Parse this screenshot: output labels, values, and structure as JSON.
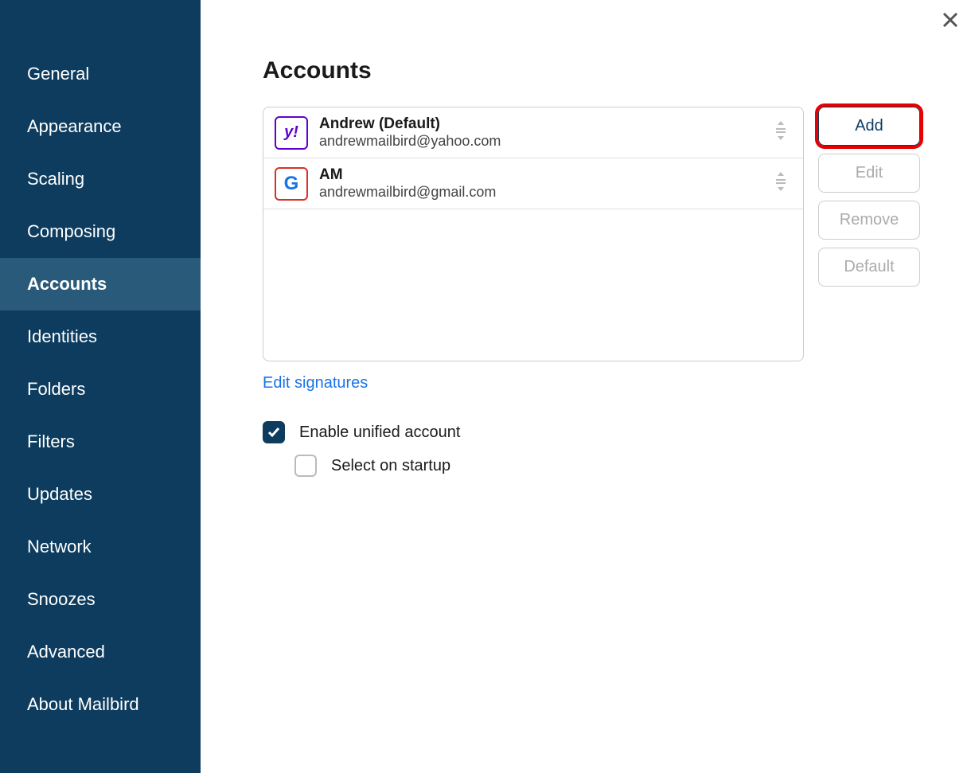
{
  "sidebar": {
    "items": [
      {
        "label": "General",
        "id": "general"
      },
      {
        "label": "Appearance",
        "id": "appearance"
      },
      {
        "label": "Scaling",
        "id": "scaling"
      },
      {
        "label": "Composing",
        "id": "composing"
      },
      {
        "label": "Accounts",
        "id": "accounts",
        "active": true
      },
      {
        "label": "Identities",
        "id": "identities"
      },
      {
        "label": "Folders",
        "id": "folders"
      },
      {
        "label": "Filters",
        "id": "filters"
      },
      {
        "label": "Updates",
        "id": "updates"
      },
      {
        "label": "Network",
        "id": "network"
      },
      {
        "label": "Snoozes",
        "id": "snoozes"
      },
      {
        "label": "Advanced",
        "id": "advanced"
      },
      {
        "label": "About Mailbird",
        "id": "about"
      }
    ]
  },
  "page": {
    "title": "Accounts"
  },
  "accounts": [
    {
      "name": "Andrew (Default)",
      "email": "andrewmailbird@yahoo.com",
      "provider": "yahoo",
      "icon_text": "y!"
    },
    {
      "name": "AM",
      "email": "andrewmailbird@gmail.com",
      "provider": "gmail",
      "icon_text": "G"
    }
  ],
  "buttons": {
    "add": "Add",
    "edit": "Edit",
    "remove": "Remove",
    "default": "Default"
  },
  "links": {
    "edit_signatures": "Edit signatures"
  },
  "options": {
    "enable_unified": "Enable unified account",
    "select_on_startup": "Select on startup"
  }
}
